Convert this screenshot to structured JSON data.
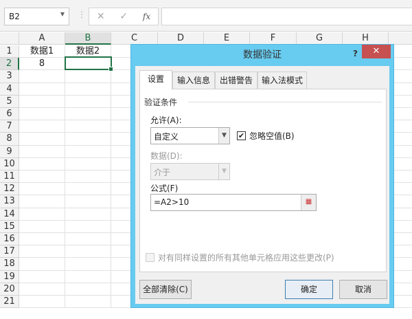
{
  "formula_bar": {
    "name_box": "B2",
    "cancel_icon": "✕",
    "enter_icon": "✓",
    "fx_label": "fx",
    "formula": ""
  },
  "columns": [
    "A",
    "B",
    "C",
    "D",
    "E",
    "F",
    "G",
    "H"
  ],
  "rows": [
    "1",
    "2",
    "3",
    "4",
    "5",
    "6",
    "7",
    "8",
    "9",
    "10",
    "11",
    "12",
    "13",
    "14",
    "15",
    "16",
    "17",
    "18",
    "19",
    "20",
    "21"
  ],
  "cells": {
    "A1": "数据1",
    "B1": "数据2",
    "A2": "8"
  },
  "dialog": {
    "title": "数据验证",
    "help": "?",
    "close": "✕",
    "tabs": [
      "设置",
      "输入信息",
      "出错警告",
      "输入法模式"
    ],
    "group_label": "验证条件",
    "allow_label": "允许(A):",
    "allow_value": "自定义",
    "ignore_blank_label": "忽略空值(B)",
    "ignore_blank_checked": true,
    "data_label": "数据(D):",
    "data_value": "介于",
    "formula_label": "公式(F)",
    "formula_value": "=A2>10",
    "apply_all_label": "对有同样设置的所有其他单元格应用这些更改(P)",
    "apply_all_checked": false,
    "clear_all": "全部清除(C)",
    "ok": "确定",
    "cancel": "取消"
  }
}
